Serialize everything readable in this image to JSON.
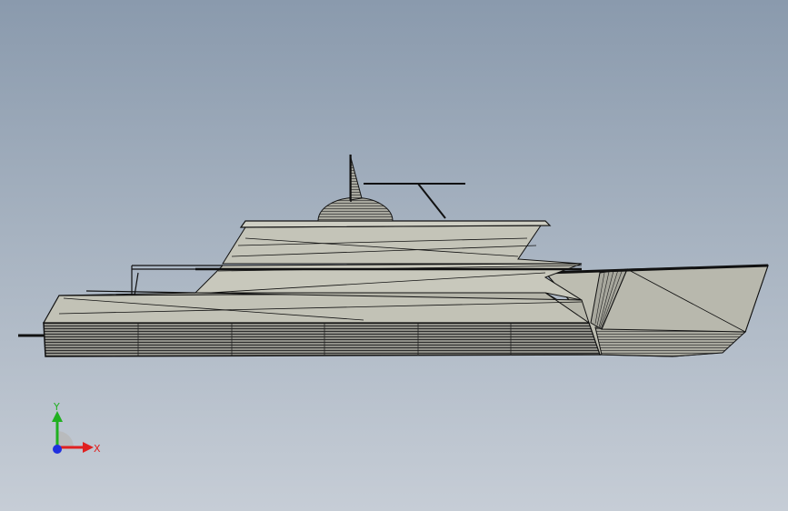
{
  "viewport": {
    "background_top": "#8a9aad",
    "background_bottom": "#c6cdd6"
  },
  "model": {
    "hull_color": "#bfbfb2",
    "hull_shade_color": "#9c9c92",
    "line_color": "#111111"
  },
  "triad": {
    "x_label": "X",
    "y_label": "Y",
    "x_color": "#e02020",
    "y_color": "#20b020",
    "z_color": "#2030e0"
  }
}
